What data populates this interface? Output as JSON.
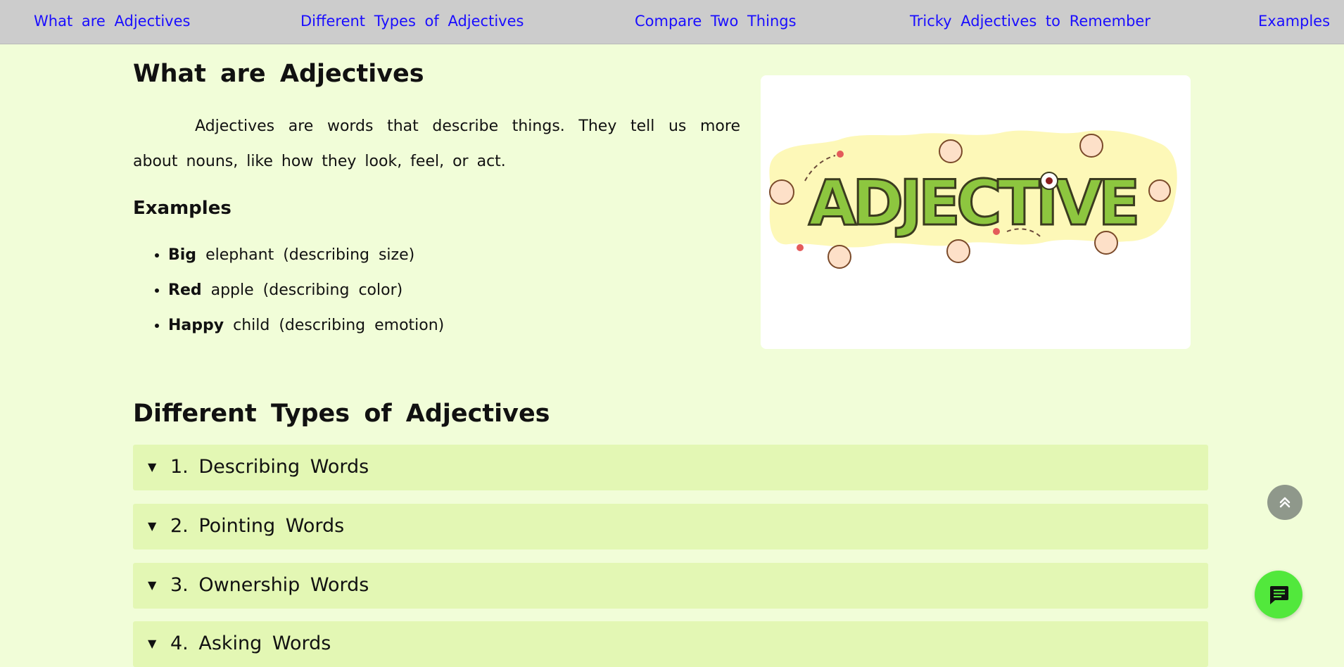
{
  "nav": {
    "items": [
      {
        "label": "What are Adjectives"
      },
      {
        "label": "Different Types of Adjectives"
      },
      {
        "label": "Compare Two Things"
      },
      {
        "label": "Tricky Adjectives to Remember"
      },
      {
        "label": "Examples"
      }
    ]
  },
  "section_what": {
    "title": "What are Adjectives",
    "intro": "Adjectives are words that describe things. They tell us more about nouns, like how they look, feel, or act.",
    "examples_heading": "Examples",
    "examples": [
      {
        "bold": "Big",
        "rest": "elephant (describing size)"
      },
      {
        "bold": "Red",
        "rest": "apple (describing color)"
      },
      {
        "bold": "Happy",
        "rest": "child (describing emotion)"
      }
    ],
    "image": {
      "wordmark": "ADJECTIVE",
      "colors": {
        "letters": "#8dc63f",
        "splash": "#fdf8b8",
        "outline": "#3b3b1f"
      }
    }
  },
  "section_types": {
    "title": "Different Types of Adjectives",
    "items": [
      {
        "label": "1. Describing Words"
      },
      {
        "label": "2. Pointing Words"
      },
      {
        "label": "3. Ownership Words"
      },
      {
        "label": "4. Asking Words"
      }
    ]
  },
  "floating": {
    "scroll_top_icon": "double-chevron-up-icon",
    "chat_icon": "chat-message-icon"
  },
  "colors": {
    "page_bg": "#f1fdd8",
    "nav_bg": "#cccccc",
    "nav_link": "#1a0dff",
    "accordion_bg": "#e3f7b4",
    "chat_button": "#52e83c",
    "scroll_button": "#8f988b"
  }
}
